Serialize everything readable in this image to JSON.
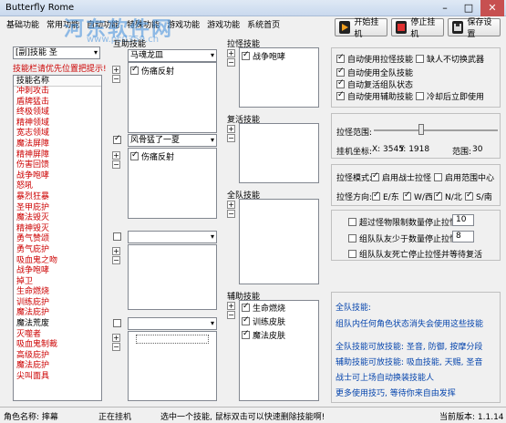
{
  "window": {
    "title": "Butterfly Rome",
    "minimize": "–",
    "maximize": "□",
    "close": "✕"
  },
  "watermark": {
    "text": "河东软件网",
    "url": "www.pc0359.cn"
  },
  "menu": [
    "基础功能",
    "常用功能",
    "自动功能",
    "特殊功能",
    "游戏功能",
    "游戏功能",
    "系统首页"
  ],
  "toolbar": {
    "start": "开始挂机",
    "stop": "停止挂机",
    "save": "保存设置"
  },
  "skills_panel": {
    "top_select": "[副]技能 圣",
    "hint": "技能栏请优先位置把提示!",
    "header": "技能名称",
    "items": [
      "冲刺攻击",
      "盾牌猛击",
      "终极领域",
      "精神领域",
      "宽志领域",
      "魔法屏障",
      "精神屏障",
      "伤害回馈",
      "战争咆哮",
      "怒吼",
      "暴烈狂暴",
      "圣甲庇护",
      "魔法毁灭",
      "精神毁灭",
      "勇气赞颂",
      "勇气庇护",
      "吸血鬼之吻",
      "战争咆哮",
      "掉卫",
      "生命燃烧",
      "训练庇护",
      "魔法庇护",
      "魔法荒废",
      "灭噬者",
      "吸血鬼制裁",
      "高级庇护",
      "魔法庇护",
      "尖叫面具"
    ],
    "selected_index": 22
  },
  "combo": {
    "label": "互助技能",
    "g1": {
      "select": "马魂龙皿",
      "checked": true,
      "item": "伤痛反射"
    },
    "g2": {
      "select": "风骨猛了一夏",
      "checked": true,
      "item": "伤痛反射"
    },
    "g3": {
      "select": "",
      "checked": false
    },
    "g4": {
      "select": "",
      "checked": false
    }
  },
  "assign": {
    "pull_label": "拉怪技能",
    "pull_items": [
      "战争咆哮"
    ],
    "buff_label": "复活技能",
    "buff_items": [],
    "team_label": "全队技能",
    "team_items": [],
    "aux_label": "辅助技能",
    "aux_items": [
      "生命燃烧",
      "训练皮肤",
      "魔法皮肤"
    ]
  },
  "options": {
    "auto_pull": "自动使用拉怪技能",
    "auto_pull_on": true,
    "no_switch": "缺人不切换武器",
    "no_switch_on": false,
    "auto_team": "自动使用全队技能",
    "auto_team_on": true,
    "auto_revive": "自动复活组队状态",
    "auto_revive_on": true,
    "auto_aux": "自动使用辅助技能",
    "auto_aux_on": true,
    "cooldown": "冷却后立即使用",
    "cooldown_on": false
  },
  "range": {
    "label": "拉怪范围:",
    "value_pct": 38
  },
  "coords": {
    "label": "挂机坐标:",
    "x": "X: 3545",
    "y": "Y: 1918",
    "range_label": "范围:",
    "range": "30"
  },
  "pull_mode": {
    "label": "拉怪模式:",
    "opt1": "启用战士拉怪",
    "opt1_on": true,
    "opt2": "启用范围中心",
    "opt2_on": false
  },
  "pull_dir": {
    "label": "拉怪方向:",
    "dirs": [
      "E/东",
      "W/西",
      "N/北",
      "S/南"
    ]
  },
  "limits": [
    {
      "label": "超过怪物限制数量停止拉怪",
      "value": "10"
    },
    {
      "label": "组队队友少于数量停止拉怪",
      "value": "8"
    },
    {
      "label": "组队队友死亡停止拉怪并等待复活",
      "value": ""
    }
  ],
  "info": [
    "全队技能:",
    "组队内任何角色状态消失会使用这些技能",
    "",
    "全队技能可放技能: 圣音, 防御, 按摩分段",
    "辅助技能可放技能: 吸血技能, 天赐, 圣音",
    "战士可上场自动换装技能人",
    "更多使用技巧, 等待你来自由发挥"
  ],
  "status": {
    "char": "角色名称: 摔幕",
    "state": "正在挂机",
    "tip": "选中一个技能, 鼠标双击可以快速删除技能啊!",
    "version": "当前版本: 1.1.14"
  }
}
